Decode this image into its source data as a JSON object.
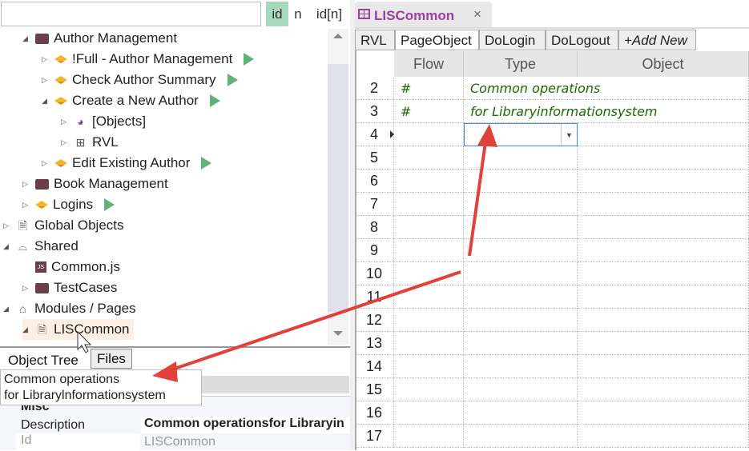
{
  "search": {
    "value": "",
    "placeholder": ""
  },
  "modes": [
    "id",
    "n",
    "id[n]"
  ],
  "tree": [
    {
      "label": "Author Management",
      "icon": "folder-icon",
      "indent": 2,
      "exp": "open"
    },
    {
      "label": "!Full - Author Management",
      "icon": "testcase-icon",
      "indent": 3,
      "exp": "closed",
      "play": true
    },
    {
      "label": "Check Author Summary",
      "icon": "testcase-icon",
      "indent": 3,
      "exp": "closed",
      "play": true
    },
    {
      "label": "Create a New Author",
      "icon": "testcase-icon",
      "indent": 3,
      "exp": "open",
      "play": true
    },
    {
      "label": "[Objects]",
      "icon": "objects-icon",
      "indent": 4,
      "exp": "closed"
    },
    {
      "label": "RVL",
      "icon": "table-icon",
      "indent": 4,
      "exp": "closed"
    },
    {
      "label": "Edit Existing Author",
      "icon": "testcase-icon",
      "indent": 3,
      "exp": "closed",
      "play": true
    },
    {
      "label": "Book Management",
      "icon": "folder-icon",
      "indent": 2,
      "exp": "closed"
    },
    {
      "label": "Logins",
      "icon": "testcase-icon",
      "indent": 2,
      "exp": "closed",
      "play": true
    },
    {
      "label": "Global Objects",
      "icon": "file-icon",
      "indent": 1,
      "exp": "closed"
    },
    {
      "label": "Shared",
      "icon": "inbox-icon",
      "indent": 1,
      "exp": "open"
    },
    {
      "label": "Common.js",
      "icon": "js-file-icon",
      "indent": 2,
      "exp": ""
    },
    {
      "label": "TestCases",
      "icon": "folder-icon",
      "indent": 2,
      "exp": "closed"
    },
    {
      "label": "Modules / Pages",
      "icon": "shapes-icon",
      "indent": 1,
      "exp": "open"
    },
    {
      "label": "LISCommon",
      "icon": "document-icon",
      "indent": 2,
      "exp": "open",
      "selected": true
    }
  ],
  "bottom_tabs": [
    "Object Tree",
    "Files"
  ],
  "tooltip": [
    "Common  operations",
    "for  Librarylnformationsystem"
  ],
  "properties": {
    "section": "Misc",
    "rows": [
      {
        "name": "Description",
        "value": "Common operationsfor Libraryin"
      },
      {
        "name": "Id",
        "value": "LISCommon"
      }
    ]
  },
  "editor_tab": {
    "title": "LISCommon",
    "close": "×"
  },
  "sheet_tabs": [
    "RVL",
    "PageObject",
    "DoLogin",
    "DoLogout",
    "+Add New"
  ],
  "columns": [
    "Flow",
    "Type",
    "Object"
  ],
  "rows": [
    {
      "n": "2",
      "flow": "#",
      "type": "Common operations"
    },
    {
      "n": "3",
      "flow": "#",
      "type": "for Libraryinformationsystem"
    },
    {
      "n": "4",
      "flow": "",
      "type": ""
    },
    {
      "n": "5"
    },
    {
      "n": "6"
    },
    {
      "n": "7"
    },
    {
      "n": "8"
    },
    {
      "n": "9"
    },
    {
      "n": "10"
    },
    {
      "n": "11"
    },
    {
      "n": "12"
    },
    {
      "n": "13"
    },
    {
      "n": "14"
    },
    {
      "n": "15"
    },
    {
      "n": "16"
    },
    {
      "n": "17"
    }
  ],
  "colors": {
    "accent": "#9b3fa0",
    "mode_active": "#a6d8bb",
    "comment": "#1a6b00",
    "arrow": "#e2403a"
  }
}
